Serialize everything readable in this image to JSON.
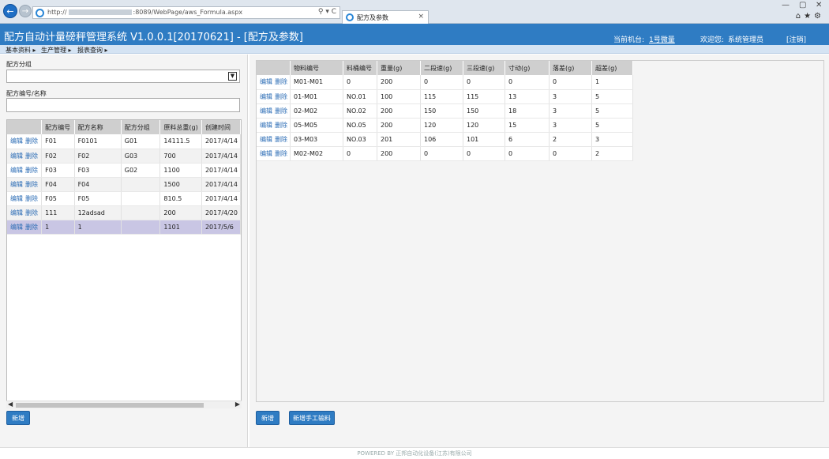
{
  "browser": {
    "url_prefix": "http://",
    "url_suffix": ":8089/WebPage/aws_Formula.aspx",
    "tab_title": "配方及参数",
    "close_glyph": "×",
    "addr_icons": "⚲ ▾ C",
    "tool_icons": "⌂★⚙",
    "win_min": "—",
    "win_max": "▢",
    "win_close": "✕"
  },
  "header": {
    "title": "配方自动计量磅秤管理系统 V1.0.0.1[20170621] - [配方及参数]",
    "machine_label": "当前机台:",
    "machine_value": "1号微量",
    "welcome_label": "欢迎您:",
    "user": "系统管理员",
    "logout": "[注销]"
  },
  "menu": [
    {
      "label": "基本资料 ▸"
    },
    {
      "label": "生产管理 ▸"
    },
    {
      "label": "报表查询 ▸"
    }
  ],
  "left": {
    "group_label": "配方分组",
    "group_value": "",
    "code_label": "配方编号/名称",
    "code_value": "",
    "columns": [
      "",
      "配方编号",
      "配方名称",
      "配方分组",
      "原料总重(g)",
      "创建时间"
    ],
    "edit_label": "编辑",
    "delete_label": "删除",
    "rows": [
      {
        "code": "F01",
        "name": "F0101",
        "group": "G01",
        "weight": "14111.5",
        "created": "2017/4/14"
      },
      {
        "code": "F02",
        "name": "F02",
        "group": "G03",
        "weight": "700",
        "created": "2017/4/14"
      },
      {
        "code": "F03",
        "name": "F03",
        "group": "G02",
        "weight": "1100",
        "created": "2017/4/14"
      },
      {
        "code": "F04",
        "name": "F04",
        "group": "",
        "weight": "1500",
        "created": "2017/4/14"
      },
      {
        "code": "F05",
        "name": "F05",
        "group": "",
        "weight": "810.5",
        "created": "2017/4/14"
      },
      {
        "code": "111",
        "name": "12adsad",
        "group": "",
        "weight": "200",
        "created": "2017/4/20"
      },
      {
        "code": "1",
        "name": "1",
        "group": "",
        "weight": "1101",
        "created": "2017/5/6"
      }
    ],
    "selected_row": 6,
    "add_button": "新增",
    "scroll_left": "◀",
    "scroll_right": "▶"
  },
  "right": {
    "columns": [
      "",
      "物料编号",
      "料桶编号",
      "重量(g)",
      "二段速(g)",
      "三段速(g)",
      "寸动(g)",
      "落差(g)",
      "超差(g)"
    ],
    "edit_label": "编辑",
    "delete_label": "删除",
    "rows": [
      {
        "material": "M01-M01",
        "bucket": "0",
        "weight": "200",
        "speed2": "0",
        "speed3": "0",
        "inch": "0",
        "drop": "0",
        "over": "1"
      },
      {
        "material": "01-M01",
        "bucket": "NO.01",
        "weight": "100",
        "speed2": "115",
        "speed3": "115",
        "inch": "13",
        "drop": "3",
        "over": "5"
      },
      {
        "material": "02-M02",
        "bucket": "NO.02",
        "weight": "200",
        "speed2": "150",
        "speed3": "150",
        "inch": "18",
        "drop": "3",
        "over": "5"
      },
      {
        "material": "05-M05",
        "bucket": "NO.05",
        "weight": "200",
        "speed2": "120",
        "speed3": "120",
        "inch": "15",
        "drop": "3",
        "over": "5"
      },
      {
        "material": "03-M03",
        "bucket": "NO.03",
        "weight": "201",
        "speed2": "106",
        "speed3": "101",
        "inch": "6",
        "drop": "2",
        "over": "3"
      },
      {
        "material": "M02-M02",
        "bucket": "0",
        "weight": "200",
        "speed2": "0",
        "speed3": "0",
        "inch": "0",
        "drop": "0",
        "over": "2"
      }
    ],
    "add_button": "新增",
    "add_manual_button": "新增手工输料"
  },
  "footer": "POWERED BY 正邦自动化设备(江苏)有限公司"
}
